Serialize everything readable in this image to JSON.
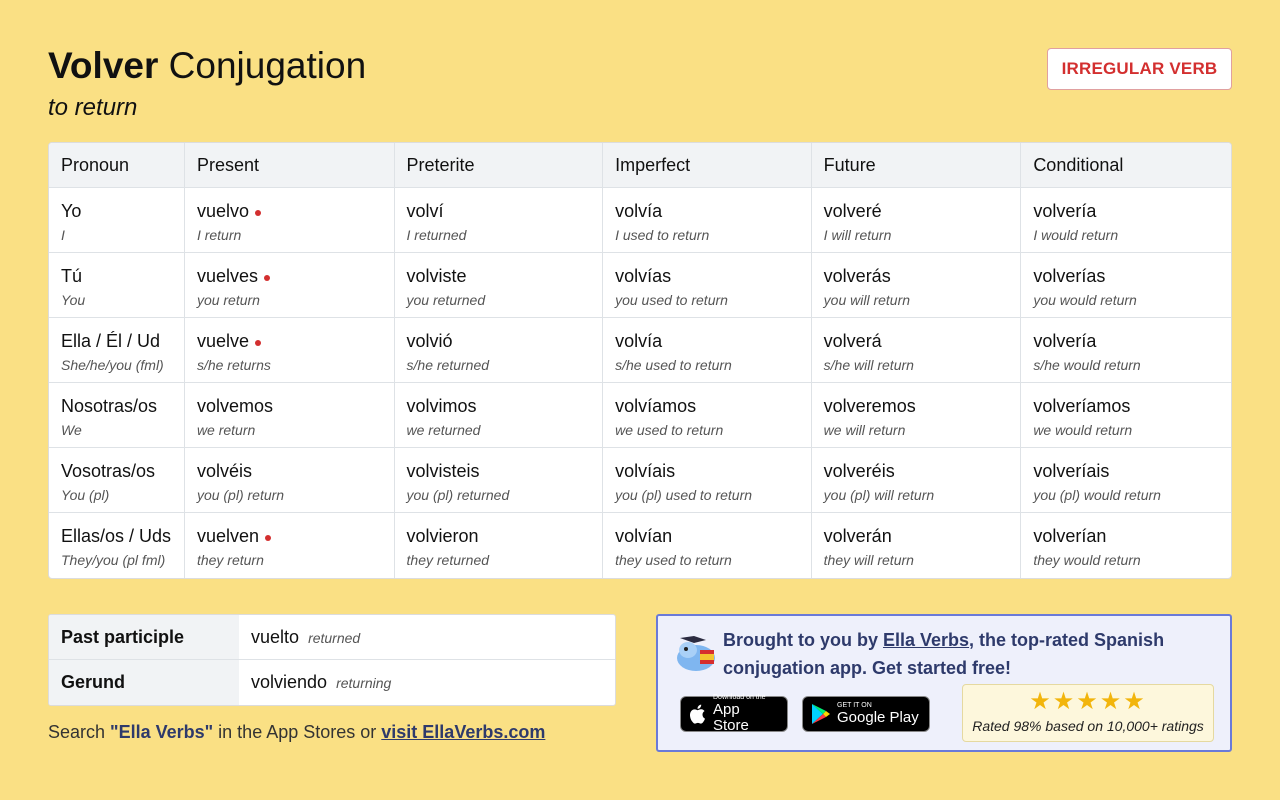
{
  "header": {
    "verb": "Volver",
    "title_rest": "Conjugation",
    "meaning": "to return",
    "badge": "IRREGULAR VERB"
  },
  "colors": {
    "background": "#fae084",
    "irregular_marker": "#d32f2f",
    "brand_text": "#2e3a6b",
    "promo_border": "#6a7ad8",
    "star": "#f2b50c"
  },
  "table": {
    "headers": [
      "Pronoun",
      "Present",
      "Preterite",
      "Imperfect",
      "Future",
      "Conditional"
    ],
    "rows": [
      {
        "pronoun": "Yo",
        "pronoun_en": "I",
        "cells": [
          {
            "form": "vuelvo",
            "en": "I return",
            "irregular": true
          },
          {
            "form": "volví",
            "en": "I returned",
            "irregular": false
          },
          {
            "form": "volvía",
            "en": "I used to return",
            "irregular": false
          },
          {
            "form": "volveré",
            "en": "I will return",
            "irregular": false
          },
          {
            "form": "volvería",
            "en": "I would return",
            "irregular": false
          }
        ]
      },
      {
        "pronoun": "Tú",
        "pronoun_en": "You",
        "cells": [
          {
            "form": "vuelves",
            "en": "you return",
            "irregular": true
          },
          {
            "form": "volviste",
            "en": "you returned",
            "irregular": false
          },
          {
            "form": "volvías",
            "en": "you used to return",
            "irregular": false
          },
          {
            "form": "volverás",
            "en": "you will return",
            "irregular": false
          },
          {
            "form": "volverías",
            "en": "you would return",
            "irregular": false
          }
        ]
      },
      {
        "pronoun": "Ella / Él / Ud",
        "pronoun_en": "She/he/you (fml)",
        "cells": [
          {
            "form": "vuelve",
            "en": "s/he returns",
            "irregular": true
          },
          {
            "form": "volvió",
            "en": "s/he returned",
            "irregular": false
          },
          {
            "form": "volvía",
            "en": "s/he used to return",
            "irregular": false
          },
          {
            "form": "volverá",
            "en": "s/he will return",
            "irregular": false
          },
          {
            "form": "volvería",
            "en": "s/he would return",
            "irregular": false
          }
        ]
      },
      {
        "pronoun": "Nosotras/os",
        "pronoun_en": "We",
        "cells": [
          {
            "form": "volvemos",
            "en": "we return",
            "irregular": false
          },
          {
            "form": "volvimos",
            "en": "we returned",
            "irregular": false
          },
          {
            "form": "volvíamos",
            "en": "we used to return",
            "irregular": false
          },
          {
            "form": "volveremos",
            "en": "we will return",
            "irregular": false
          },
          {
            "form": "volveríamos",
            "en": "we would return",
            "irregular": false
          }
        ]
      },
      {
        "pronoun": "Vosotras/os",
        "pronoun_en": "You (pl)",
        "cells": [
          {
            "form": "volvéis",
            "en": "you (pl) return",
            "irregular": false
          },
          {
            "form": "volvisteis",
            "en": "you (pl) returned",
            "irregular": false
          },
          {
            "form": "volvíais",
            "en": "you (pl) used to return",
            "irregular": false
          },
          {
            "form": "volveréis",
            "en": "you (pl) will return",
            "irregular": false
          },
          {
            "form": "volveríais",
            "en": "you (pl) would return",
            "irregular": false
          }
        ]
      },
      {
        "pronoun": "Ellas/os / Uds",
        "pronoun_en": "They/you (pl fml)",
        "cells": [
          {
            "form": "vuelven",
            "en": "they return",
            "irregular": true
          },
          {
            "form": "volvieron",
            "en": "they returned",
            "irregular": false
          },
          {
            "form": "volvían",
            "en": "they used to return",
            "irregular": false
          },
          {
            "form": "volverán",
            "en": "they will return",
            "irregular": false
          },
          {
            "form": "volverían",
            "en": "they would return",
            "irregular": false
          }
        ]
      }
    ]
  },
  "participles": {
    "past_label": "Past participle",
    "past_form": "vuelto",
    "past_en": "returned",
    "gerund_label": "Gerund",
    "gerund_form": "volviendo",
    "gerund_en": "returning"
  },
  "footer": {
    "search_prefix": "Search ",
    "search_term": "\"Ella Verbs\"",
    "search_middle": " in the App Stores or ",
    "visit_link": "visit EllaVerbs.com"
  },
  "promo": {
    "text_before": "Brought to you by ",
    "link": "Ella Verbs",
    "text_after": ", the top-rated Spanish conjugation app. Get started free!",
    "app_store_small": "Download on the",
    "app_store_big": "App Store",
    "google_small": "GET IT ON",
    "google_big": "Google Play",
    "stars": "★★★★★",
    "rating_text": "Rated 98% based on 10,000+ ratings",
    "logo_icon": "ella-verbs-logo"
  }
}
